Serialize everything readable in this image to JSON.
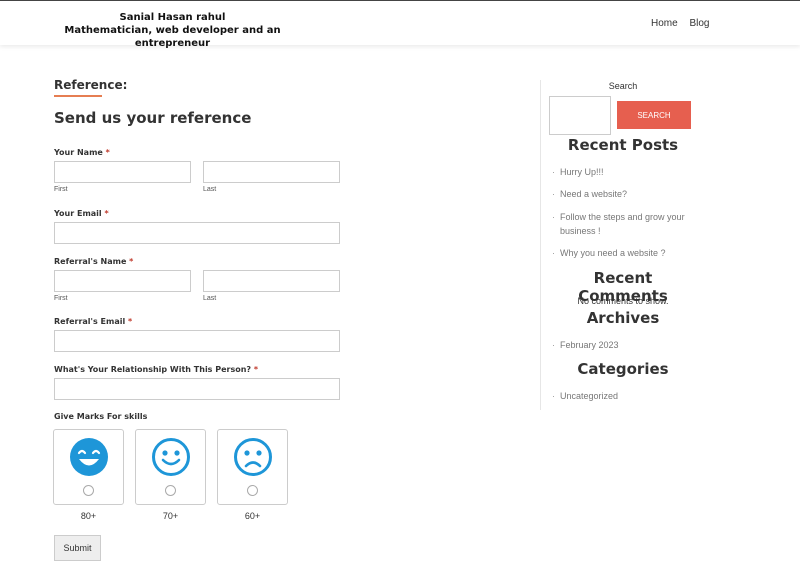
{
  "site": {
    "name": "Sanial Hasan rahul",
    "tagline": "Mathematician, web developer and an entrepreneur"
  },
  "nav": {
    "home": "Home",
    "blog": "Blog"
  },
  "page": {
    "title": "Reference:",
    "heading": "Send us your reference"
  },
  "form": {
    "your_name_label": "Your Name",
    "your_email_label": "Your Email",
    "referral_name_label": "Referral's Name",
    "referral_email_label": "Referral's Email",
    "relationship_label": "What's Your Relationship With This Person?",
    "required_mark": "*",
    "first": "First",
    "last": "Last",
    "marks_label": "Give Marks For skills",
    "marks": [
      "80+",
      "70+",
      "60+"
    ],
    "submit": "Submit"
  },
  "sidebar": {
    "search_label": "Search",
    "search_button": "SEARCH",
    "recent_posts_title": "Recent Posts",
    "recent_posts": [
      "Hurry Up!!!",
      "Need a website?",
      "Follow the steps and grow your business !",
      "Why you need a website ?"
    ],
    "recent_comments_title": "Recent Comments",
    "no_comments": "No comments to show.",
    "archives_title": "Archives",
    "archives": [
      "February 2023"
    ],
    "categories_title": "Categories",
    "categories": [
      "Uncategorized"
    ]
  },
  "colors": {
    "accent": "#e65f4f",
    "underline": "#e67e52",
    "emoji_blue": "#1e96d8"
  }
}
